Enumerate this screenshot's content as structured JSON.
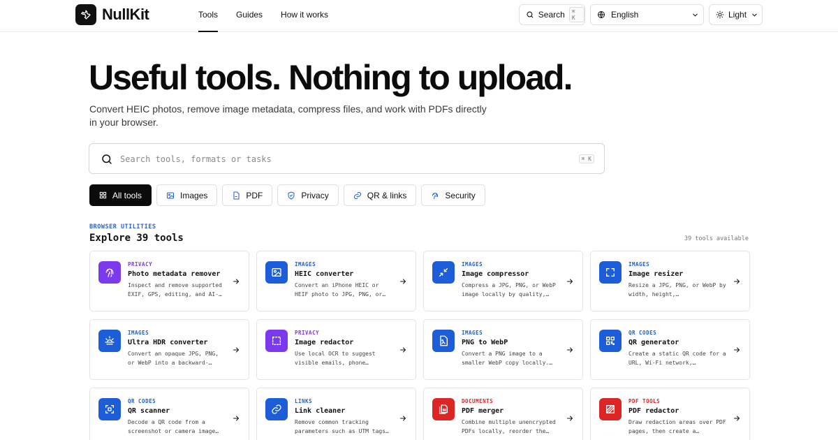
{
  "header": {
    "logo_text": "NullKit",
    "nav": [
      "Tools",
      "Guides",
      "How it works"
    ],
    "search_label": "Search",
    "search_shortcut": "⌘ K",
    "language": "English",
    "theme": "Light"
  },
  "hero": {
    "title": "Useful tools. Nothing to upload.",
    "subtitle": "Convert HEIC photos, remove image metadata, compress files, and work with PDFs directly in your browser.",
    "search_placeholder": "Search tools, formats or tasks",
    "search_shortcut": "⌘ K"
  },
  "filters": [
    "All tools",
    "Images",
    "PDF",
    "Privacy",
    "QR & links",
    "Security"
  ],
  "section": {
    "eyebrow": "BROWSER UTILITIES",
    "title": "Explore 39 tools",
    "count": "39 tools available"
  },
  "colors": {
    "privacy": "#7c3aed",
    "images": "#1d5ed8",
    "links": "#1d5ed8",
    "documents": "#dc2626",
    "pdf": "#dc2626"
  },
  "tools": [
    {
      "category": "PRIVACY",
      "title": "Photo metadata remover",
      "desc": "Inspect and remove supported EXIF, GPS, editing, and AI-…",
      "icon": "fingerprint-icon",
      "color": "#7c3aed"
    },
    {
      "category": "IMAGES",
      "title": "HEIC converter",
      "desc": "Convert an iPhone HEIC or HEIF photo to JPG, PNG, or…",
      "icon": "image-icon",
      "color": "#1d5ed8"
    },
    {
      "category": "IMAGES",
      "title": "Image compressor",
      "desc": "Compress a JPG, PNG, or WebP image locally by quality,…",
      "icon": "compress-icon",
      "color": "#1d5ed8"
    },
    {
      "category": "IMAGES",
      "title": "Image resizer",
      "desc": "Resize a JPG, PNG, or WebP by width, height,…",
      "icon": "resize-icon",
      "color": "#1d5ed8"
    },
    {
      "category": "IMAGES",
      "title": "Ultra HDR converter",
      "desc": "Convert an opaque JPG, PNG, or WebP into a backward-…",
      "icon": "sunrise-icon",
      "color": "#1d5ed8"
    },
    {
      "category": "PRIVACY",
      "title": "Image redactor",
      "desc": "Use local OCR to suggest visible emails, phone…",
      "icon": "dashed-square-icon",
      "color": "#7c3aed"
    },
    {
      "category": "IMAGES",
      "title": "PNG to WebP",
      "desc": "Convert a PNG image to a smaller WebP copy locally.…",
      "icon": "file-image-icon",
      "color": "#1d5ed8"
    },
    {
      "category": "QR CODES",
      "title": "QR generator",
      "desc": "Create a static QR code for a URL, Wi-Fi network,…",
      "icon": "qr-code-icon",
      "color": "#1d5ed8"
    },
    {
      "category": "QR CODES",
      "title": "QR scanner",
      "desc": "Decode a QR code from a screenshot or camera image…",
      "icon": "scan-icon",
      "color": "#1d5ed8"
    },
    {
      "category": "LINKS",
      "title": "Link cleaner",
      "desc": "Remove common tracking parameters such as UTM tags…",
      "icon": "link-icon",
      "color": "#1d5ed8"
    },
    {
      "category": "DOCUMENTS",
      "title": "PDF merger",
      "desc": "Combine multiple unencrypted PDFs locally, reorder the…",
      "icon": "files-icon",
      "color": "#dc2626"
    },
    {
      "category": "PDF TOOLS",
      "title": "PDF redactor",
      "desc": "Draw redaction areas over PDF pages, then create a…",
      "icon": "redact-icon",
      "color": "#dc2626"
    }
  ]
}
